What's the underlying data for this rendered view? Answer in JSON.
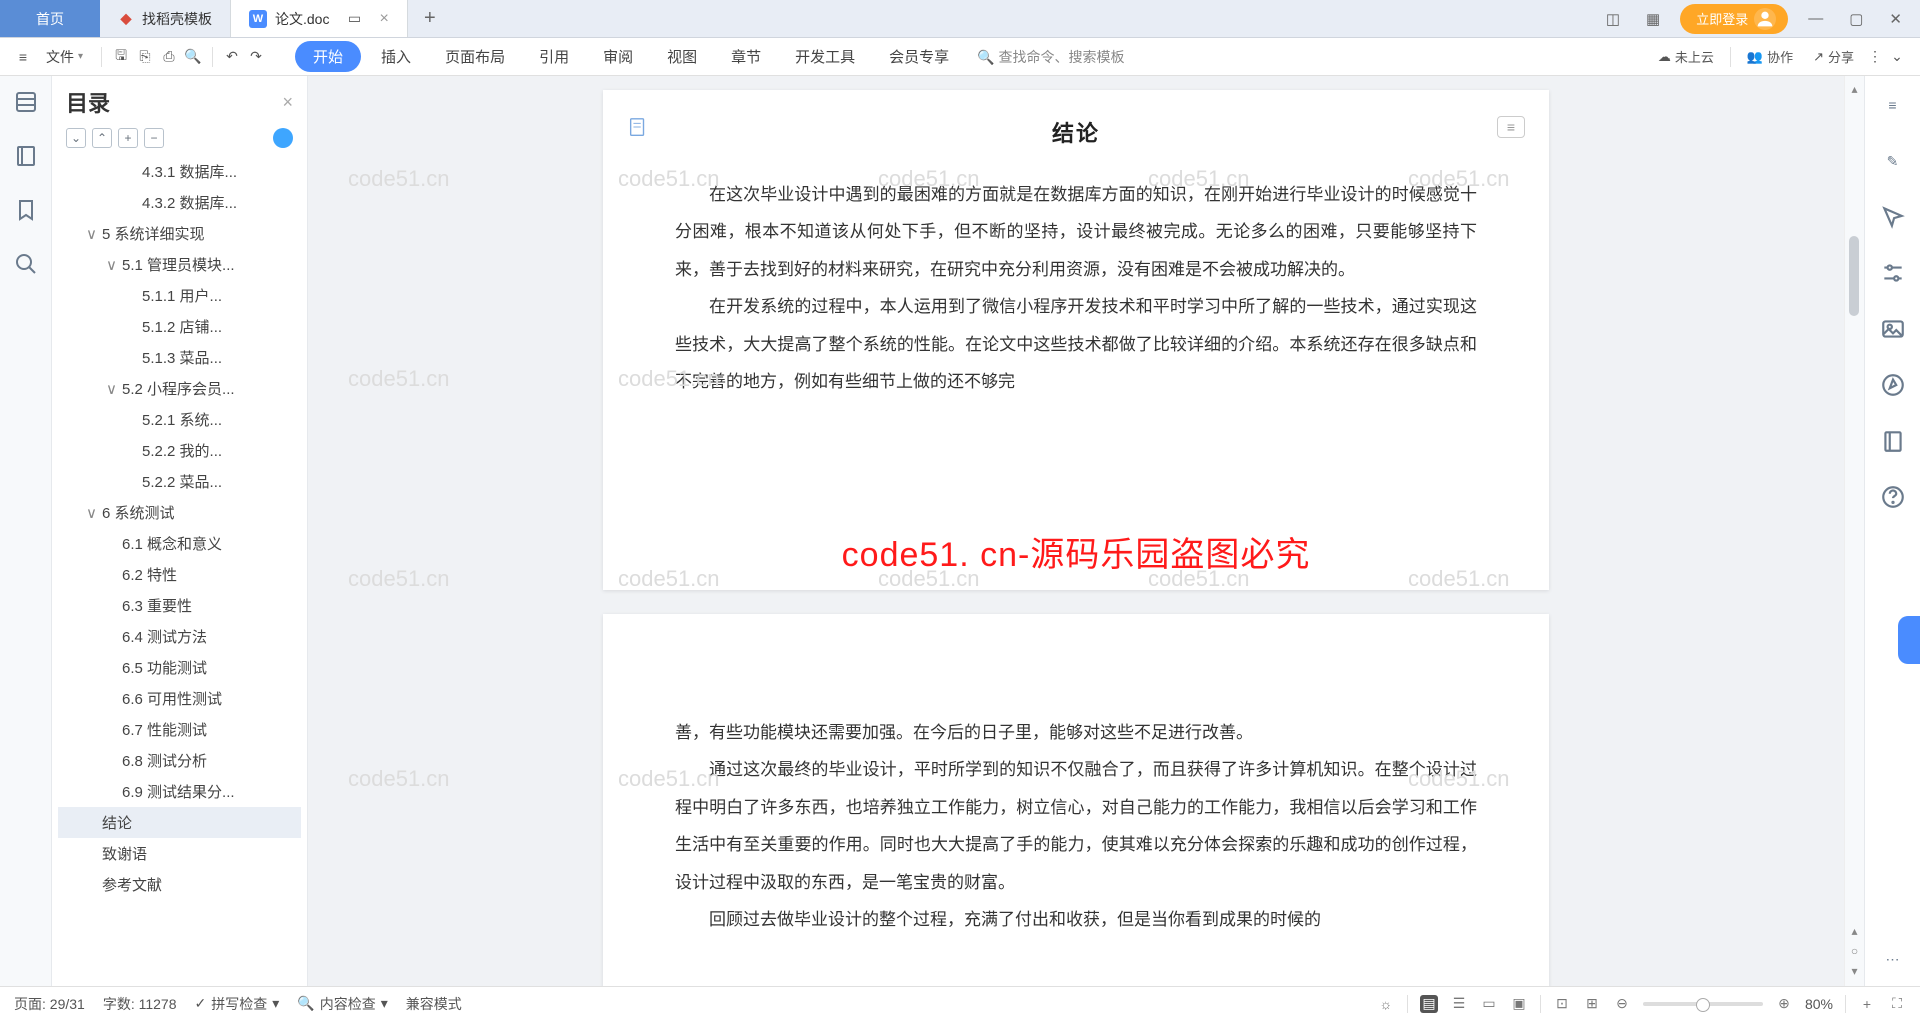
{
  "tabs": {
    "home": "首页",
    "template": "找稻壳模板",
    "document": "论文.doc"
  },
  "login_label": "立即登录",
  "ribbon": {
    "file": "文件",
    "tabs": [
      "开始",
      "插入",
      "页面布局",
      "引用",
      "审阅",
      "视图",
      "章节",
      "开发工具",
      "会员专享"
    ],
    "search_placeholder": "查找命令、搜索模板",
    "cloud": "未上云",
    "collab": "协作",
    "share": "分享"
  },
  "outline": {
    "title": "目录",
    "items": [
      {
        "level": 4,
        "label": "4.3.1 数据库...",
        "toggle": ""
      },
      {
        "level": 4,
        "label": "4.3.2 数据库...",
        "toggle": ""
      },
      {
        "level": 2,
        "label": "5 系统详细实现",
        "toggle": "∨"
      },
      {
        "level": 3,
        "label": "5.1 管理员模块...",
        "toggle": "∨"
      },
      {
        "level": 4,
        "label": "5.1.1 用户...",
        "toggle": ""
      },
      {
        "level": 4,
        "label": "5.1.2 店铺...",
        "toggle": ""
      },
      {
        "level": 4,
        "label": "5.1.3 菜品...",
        "toggle": ""
      },
      {
        "level": 3,
        "label": "5.2 小程序会员...",
        "toggle": "∨"
      },
      {
        "level": 4,
        "label": "5.2.1 系统...",
        "toggle": ""
      },
      {
        "level": 4,
        "label": "5.2.2 我的...",
        "toggle": ""
      },
      {
        "level": 4,
        "label": "5.2.2 菜品...",
        "toggle": ""
      },
      {
        "level": 2,
        "label": "6 系统测试",
        "toggle": "∨"
      },
      {
        "level": 3,
        "label": "6.1 概念和意义",
        "toggle": ""
      },
      {
        "level": 3,
        "label": "6.2 特性",
        "toggle": ""
      },
      {
        "level": 3,
        "label": "6.3 重要性",
        "toggle": ""
      },
      {
        "level": 3,
        "label": "6.4 测试方法",
        "toggle": ""
      },
      {
        "level": 3,
        "label": "6.5 功能测试",
        "toggle": ""
      },
      {
        "level": 3,
        "label": "6.6 可用性测试",
        "toggle": ""
      },
      {
        "level": 3,
        "label": "6.7 性能测试",
        "toggle": ""
      },
      {
        "level": 3,
        "label": "6.8 测试分析",
        "toggle": ""
      },
      {
        "level": 3,
        "label": "6.9 测试结果分...",
        "toggle": ""
      },
      {
        "level": 2,
        "label": "结论",
        "toggle": "",
        "selected": true
      },
      {
        "level": 2,
        "label": "致谢语",
        "toggle": ""
      },
      {
        "level": 2,
        "label": "参考文献",
        "toggle": ""
      }
    ]
  },
  "document": {
    "heading": "结论",
    "para1": "在这次毕业设计中遇到的最困难的方面就是在数据库方面的知识，在刚开始进行毕业设计的时候感觉十分困难，根本不知道该从何处下手，但不断的坚持，设计最终被完成。无论多么的困难，只要能够坚持下来，善于去找到好的材料来研究，在研究中充分利用资源，没有困难是不会被成功解决的。",
    "para2": "在开发系统的过程中，本人运用到了微信小程序开发技术和平时学习中所了解的一些技术，通过实现这些技术，大大提高了整个系统的性能。在论文中这些技术都做了比较详细的介绍。本系统还存在很多缺点和不完善的地方，例如有些细节上做的还不够完",
    "para3": "善，有些功能模块还需要加强。在今后的日子里，能够对这些不足进行改善。",
    "para4": "通过这次最终的毕业设计，平时所学到的知识不仅融合了，而且获得了许多计算机知识。在整个设计过程中明白了许多东西，也培养独立工作能力，树立信心，对自己能力的工作能力，我相信以后会学习和工作生活中有至关重要的作用。同时也大大提高了手的能力，使其难以充分体会探索的乐趣和成功的创作过程，设计过程中汲取的东西，是一笔宝贵的财富。",
    "para5": "回顾过去做毕业设计的整个过程，充满了付出和收获，但是当你看到成果的时候的",
    "watermark_red": "code51. cn-源码乐园盗图必究",
    "watermark_grey": "code51.cn"
  },
  "status": {
    "page": "页面: 29/31",
    "words": "字数: 11278",
    "spell": "拼写检查",
    "content": "内容检查",
    "compat": "兼容模式",
    "zoom": "80%"
  }
}
